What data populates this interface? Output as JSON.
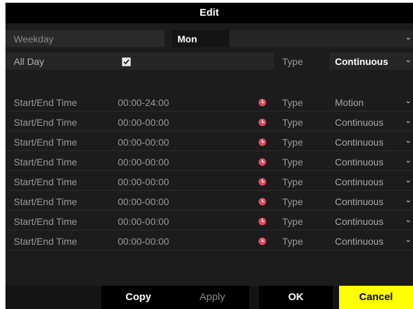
{
  "dialog": {
    "title": "Edit"
  },
  "weekday": {
    "label": "Weekday",
    "value": "Mon"
  },
  "all_day": {
    "label": "All Day",
    "checked": true,
    "type_label": "Type",
    "type_value": "Continuous"
  },
  "schedule": [
    {
      "label": "Start/End Time",
      "time": "00:00-24:00",
      "type_label": "Type",
      "type_value": "Motion"
    },
    {
      "label": "Start/End Time",
      "time": "00:00-00:00",
      "type_label": "Type",
      "type_value": "Continuous"
    },
    {
      "label": "Start/End Time",
      "time": "00:00-00:00",
      "type_label": "Type",
      "type_value": "Continuous"
    },
    {
      "label": "Start/End Time",
      "time": "00:00-00:00",
      "type_label": "Type",
      "type_value": "Continuous"
    },
    {
      "label": "Start/End Time",
      "time": "00:00-00:00",
      "type_label": "Type",
      "type_value": "Continuous"
    },
    {
      "label": "Start/End Time",
      "time": "00:00-00:00",
      "type_label": "Type",
      "type_value": "Continuous"
    },
    {
      "label": "Start/End Time",
      "time": "00:00-00:00",
      "type_label": "Type",
      "type_value": "Continuous"
    },
    {
      "label": "Start/End Time",
      "time": "00:00-00:00",
      "type_label": "Type",
      "type_value": "Continuous"
    }
  ],
  "buttons": {
    "copy": "Copy",
    "apply": "Apply",
    "ok": "OK",
    "cancel": "Cancel"
  },
  "icons": {
    "dropdown": "chevron-down-icon",
    "time_picker": "clock-icon",
    "checkbox": "checkmark-icon"
  },
  "colors": {
    "background": "#1c1c1c",
    "title_bar": "#000000",
    "field": "#262626",
    "clock_icon": "#e24a60",
    "cancel_button": "#ffff00"
  }
}
